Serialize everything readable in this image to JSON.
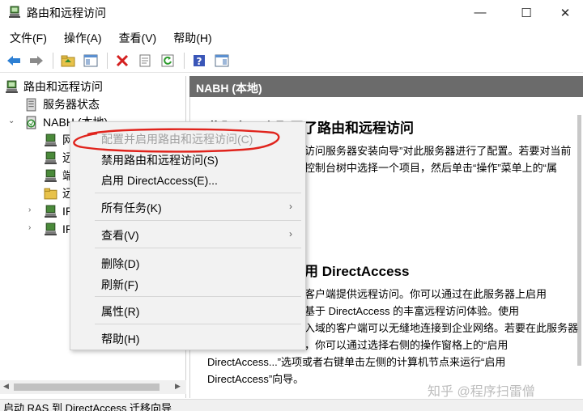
{
  "window": {
    "title": "路由和远程访问",
    "icon": "server-icon",
    "controls": {
      "minimize": "—",
      "maximize": "☐",
      "close": "✕"
    }
  },
  "menubar": [
    "文件(F)",
    "操作(A)",
    "查看(V)",
    "帮助(H)"
  ],
  "toolbar": {
    "icons": [
      "back-arrow-icon",
      "forward-arrow-icon",
      "up-folder-icon",
      "console-tree-icon",
      "delete-icon",
      "properties-icon",
      "refresh-icon",
      "help-icon",
      "action-pane-icon"
    ]
  },
  "tree": {
    "root": "路由和远程访问",
    "server_status": "服务器状态",
    "server_node": "NABH (本地)",
    "children_partial": [
      "网",
      "远",
      "端",
      "远",
      "IP",
      "IP"
    ]
  },
  "right_pane": {
    "header": "NABH (本地)",
    "section1_heading": "此服务器上配置了路由和远程访问",
    "section1_lines": [
      "访问服务器安装向导”对此服务器进行了配置。若要对当前",
      "控制台树中选择一个项目，然后单击“操作”菜单上的“属"
    ],
    "section2_heading": "用 DirectAccess",
    "section2_lines": [
      "客户端提供远程访问。你可以通过在此服务器上启用",
      "基于 DirectAccess 的丰富远程访问体验。使用",
      "入域的客户端可以无缝地连接到企业网络。若要在此服务器",
      "，你可以通过选择右侧的操作窗格上的“启用",
      "DirectAccess...”选项或者右键单击左侧的计算机节点来运行“启用",
      "DirectAccess”向导。"
    ]
  },
  "context_menu": {
    "items": [
      {
        "label": "配置并启用路由和远程访问(C)",
        "disabled": true
      },
      {
        "label": "禁用路由和远程访问(S)",
        "disabled": false
      },
      {
        "label": "启用 DirectAccess(E)...",
        "disabled": false
      },
      {
        "label": "所有任务(K)",
        "disabled": false,
        "submenu": true
      },
      {
        "label": "查看(V)",
        "disabled": false,
        "submenu": true
      },
      {
        "label": "删除(D)",
        "disabled": false
      },
      {
        "label": "刷新(F)",
        "disabled": false
      },
      {
        "label": "属性(R)",
        "disabled": false
      },
      {
        "label": "帮助(H)",
        "disabled": false
      }
    ]
  },
  "watermark": "知乎 @程序扫雷僧",
  "statusbar": "启动 RAS 到 DirectAccess 迁移向导",
  "colors": {
    "header_bg": "#6b6b6b",
    "annotation_red": "#e0231c",
    "menu_bg": "#f2f2f2"
  }
}
